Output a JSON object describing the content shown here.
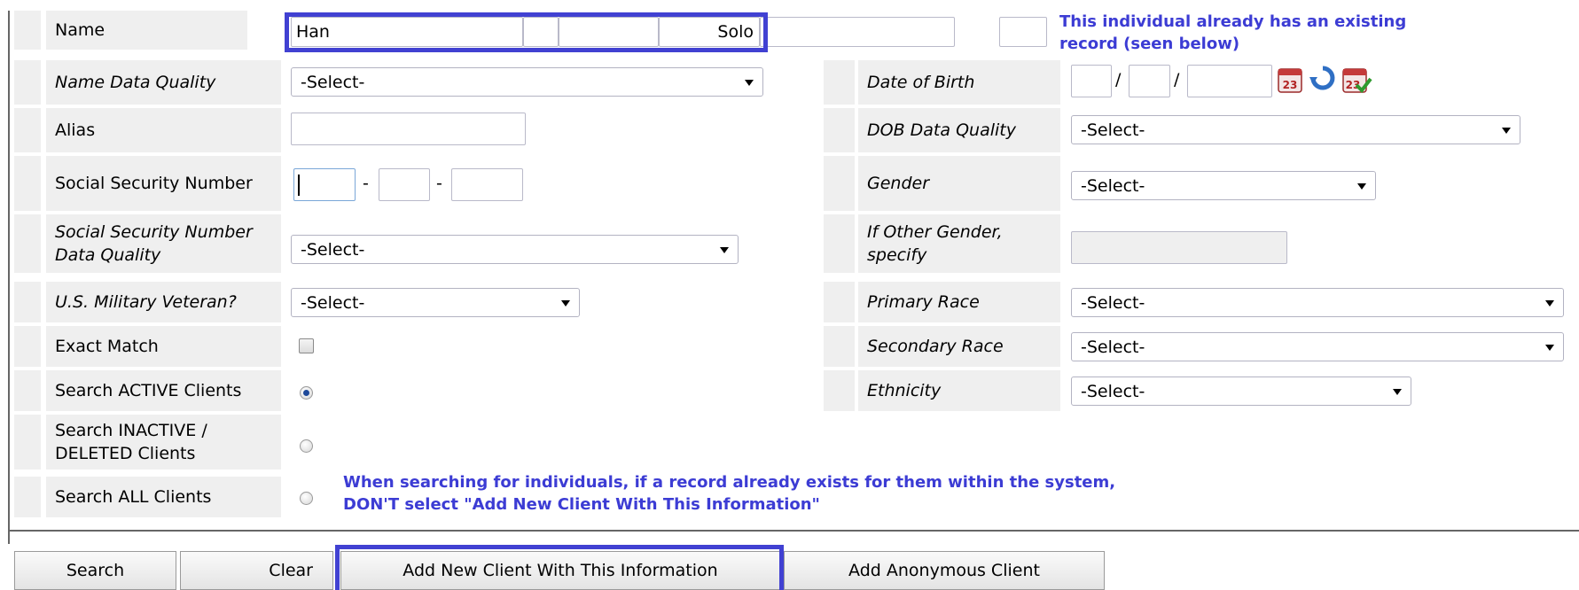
{
  "name_row": {
    "label": "Name",
    "first": "Han",
    "middle": "",
    "extra": "",
    "last": "Solo",
    "suffix": "",
    "existing_notice": "This individual already has an existing record (seen below)"
  },
  "left_fields": {
    "name_dq": {
      "label": "Name Data Quality",
      "value": "-Select-"
    },
    "alias": {
      "label": "Alias",
      "value": ""
    },
    "ssn": {
      "label": "Social Security Number",
      "part1": "",
      "part2": "",
      "part3": "",
      "sep": "-"
    },
    "ssn_dq": {
      "label": "Social Security Number Data Quality",
      "value": "-Select-"
    },
    "veteran": {
      "label": "U.S. Military Veteran?",
      "value": "-Select-"
    },
    "exact_match": {
      "label": "Exact Match",
      "checked": false
    },
    "search_active": {
      "label": "Search ACTIVE Clients",
      "checked": true
    },
    "search_inactive": {
      "label": "Search INACTIVE / DELETED Clients",
      "checked": false
    },
    "search_all": {
      "label": "Search ALL Clients",
      "checked": false
    }
  },
  "right_fields": {
    "dob": {
      "label": "Date of Birth",
      "month": "",
      "day": "",
      "year": "",
      "sep": "/"
    },
    "dob_dq": {
      "label": "DOB Data Quality",
      "value": "-Select-"
    },
    "gender": {
      "label": "Gender",
      "value": "-Select-"
    },
    "other_gender": {
      "label": "If Other Gender, specify",
      "value": ""
    },
    "primary_race": {
      "label": "Primary Race",
      "value": "-Select-"
    },
    "secondary_race": {
      "label": "Secondary Race",
      "value": "-Select-"
    },
    "ethnicity": {
      "label": "Ethnicity",
      "value": "-Select-"
    }
  },
  "warning": "When searching for individuals, if a record already exists for them within the system, DON'T select \"Add New Client With This Information\"",
  "buttons": {
    "search": "Search",
    "clear": "Clear",
    "add_new": "Add New Client With This Information",
    "add_anon": "Add Anonymous Client"
  },
  "colors": {
    "highlight": "#4141d2",
    "notice_text": "#3c3cd4",
    "label_bg": "#efefef"
  }
}
